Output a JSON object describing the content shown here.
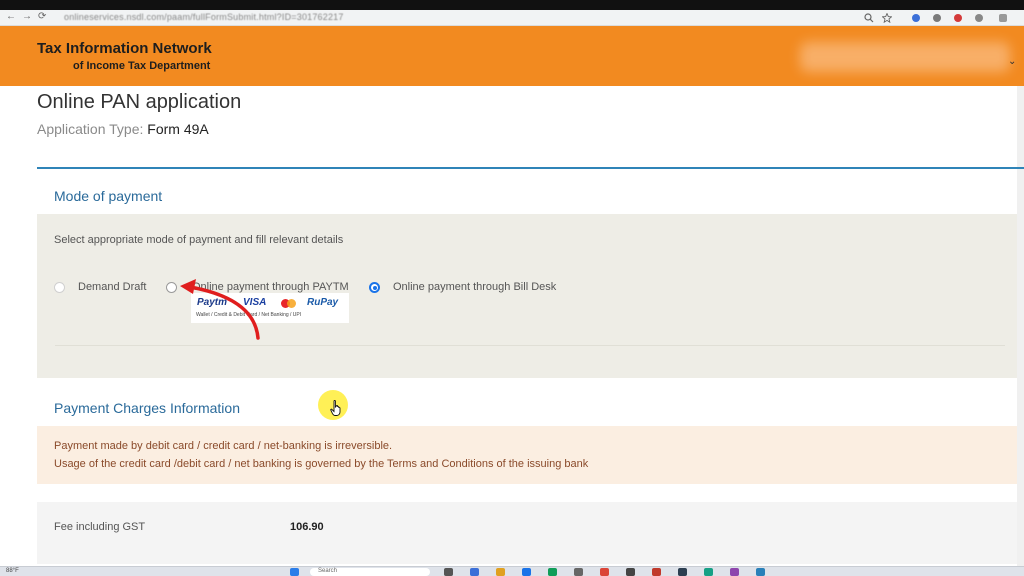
{
  "browser": {
    "url": "onlineservices.nsdl.com/paam/fullFormSubmit.html?ID=301762217",
    "nav_back": "←",
    "nav_forward": "→",
    "nav_reload": "⟳",
    "zoom_icon": "search-icon",
    "bookmark_icon": "star-icon"
  },
  "header": {
    "brand_line1": "Tax Information Network",
    "brand_line2": "of Income Tax Department",
    "menu_chevron": "⌄",
    "bg_color": "#f28a20"
  },
  "page": {
    "title": "Online PAN application",
    "app_type_label": "Application Type: ",
    "app_type_value": "Form 49A"
  },
  "payment": {
    "section_title": "Mode of payment",
    "hint": "Select appropriate mode of payment and fill relevant details",
    "options": [
      {
        "label": "Demand Draft",
        "selected": false
      },
      {
        "label": "Online payment through PAYTM",
        "selected": false
      },
      {
        "label": "Online payment through Bill Desk",
        "selected": true
      }
    ],
    "logos": {
      "paytm": "Paytm",
      "visa": "VISA",
      "rupay": "RuPay",
      "caption": "Wallet / Credit & Debit Card / Net Banking / UPI"
    }
  },
  "charges": {
    "section_title": "Payment Charges Information",
    "notice_line1": "Payment made by debit card / credit card / net-banking is irreversible.",
    "notice_line2": "Usage of the credit card /debit card / net banking is governed by the Terms and Conditions of the issuing bank",
    "fee_label": "Fee including GST",
    "fee_value": "106.90"
  },
  "taskbar": {
    "weather": "88°F",
    "search_placeholder": "Search"
  },
  "colors": {
    "accent_blue": "#2f84b8",
    "annotation_red": "#e01e1e",
    "cursor_highlight": "#ffeb1e"
  }
}
